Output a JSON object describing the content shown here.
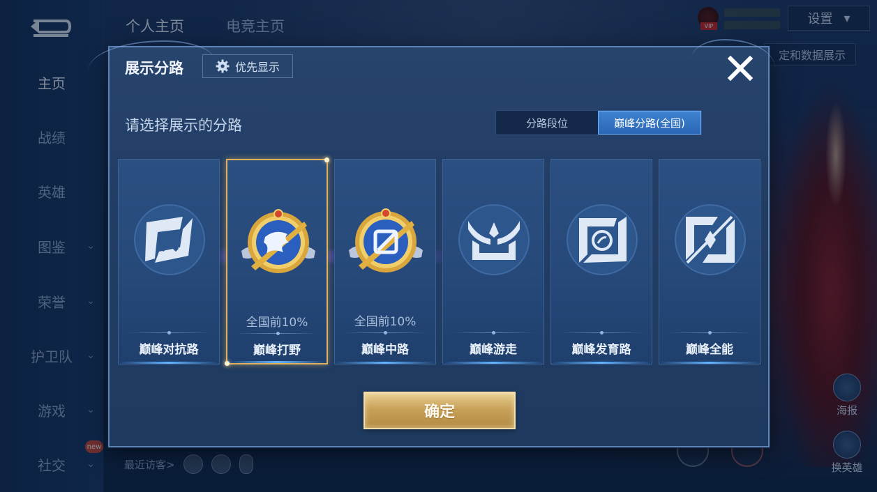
{
  "background": {
    "sidebar": {
      "items": [
        {
          "label": "主页",
          "active": true,
          "expandable": false
        },
        {
          "label": "战绩",
          "active": false,
          "expandable": false
        },
        {
          "label": "英雄",
          "active": false,
          "expandable": false
        },
        {
          "label": "图鉴",
          "active": false,
          "expandable": true
        },
        {
          "label": "荣誉",
          "active": false,
          "expandable": true
        },
        {
          "label": "护卫队",
          "active": false,
          "expandable": true
        },
        {
          "label": "游戏",
          "active": false,
          "expandable": true
        },
        {
          "label": "社交",
          "active": false,
          "expandable": true
        }
      ],
      "chevron": "⌄",
      "new_badge": "new"
    },
    "top_tabs": [
      "个人主页",
      "电竞主页"
    ],
    "settings_label": "设置",
    "settings_chevron": "▾",
    "vip_tag": "VIP",
    "data_display_label": "定和数据展示",
    "recent_visitors_label": "最近访客>",
    "right_buttons": [
      {
        "label": "海报",
        "icon": "poster-icon"
      },
      {
        "label": "换英雄",
        "icon": "swap-hero-icon"
      }
    ]
  },
  "dialog": {
    "title": "展示分路",
    "priority_label": "优先显示",
    "close_icon": "close-icon",
    "subtitle": "请选择展示的分路",
    "toggle": {
      "options": [
        "分路段位",
        "巅峰分路(全国)"
      ],
      "selected_index": 1
    },
    "cards": [
      {
        "name": "巅峰对抗路",
        "rank": "",
        "selected": false,
        "emblem": "top-lane-emblem-icon",
        "ranked": false
      },
      {
        "name": "巅峰打野",
        "rank": "全国前10%",
        "selected": true,
        "emblem": "jungle-dragon-emblem-icon",
        "ranked": true
      },
      {
        "name": "巅峰中路",
        "rank": "全国前10%",
        "selected": false,
        "emblem": "mid-lane-emblem-icon",
        "ranked": true
      },
      {
        "name": "巅峰游走",
        "rank": "",
        "selected": false,
        "emblem": "roam-wings-emblem-icon",
        "ranked": false
      },
      {
        "name": "巅峰发育路",
        "rank": "",
        "selected": false,
        "emblem": "farm-lane-emblem-icon",
        "ranked": false
      },
      {
        "name": "巅峰全能",
        "rank": "",
        "selected": false,
        "emblem": "all-round-emblem-icon",
        "ranked": false
      }
    ],
    "confirm_label": "确定"
  },
  "colors": {
    "accent_blue": "#2a66b3",
    "selected_gold": "#e2b15c",
    "confirm_gold": "#c9a25a",
    "dialog_bg": "#223d64"
  }
}
